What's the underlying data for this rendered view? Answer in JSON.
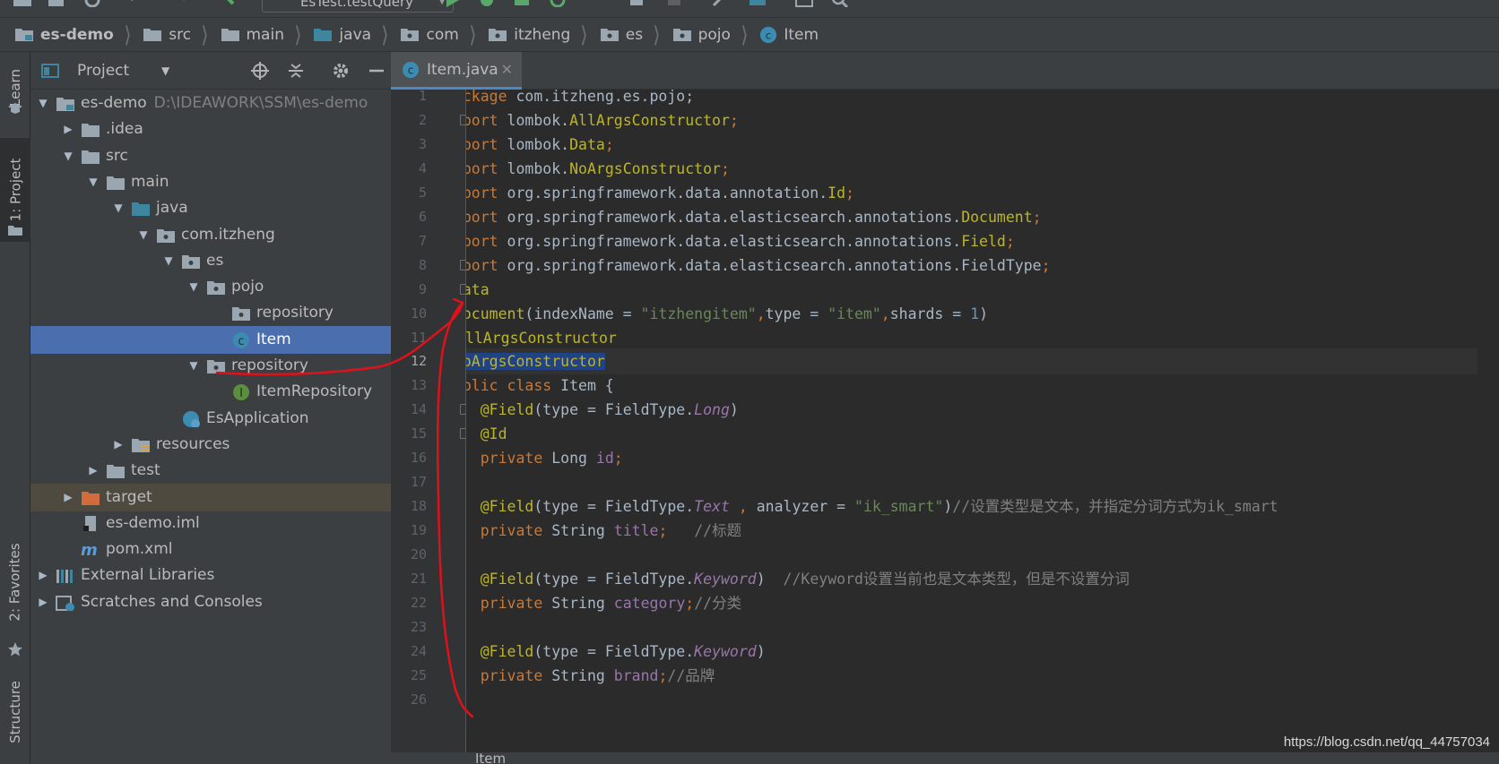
{
  "toolbar": {
    "run_config": "EsTest.testQuery"
  },
  "breadcrumb": [
    "es-demo",
    "src",
    "main",
    "java",
    "com",
    "itzheng",
    "es",
    "pojo",
    "Item"
  ],
  "left_strip": {
    "learn": "Learn",
    "project": "1: Project",
    "favorites": "2: Favorites",
    "structure": "Structure"
  },
  "project_panel": {
    "title": "Project",
    "tree": [
      {
        "label": "es-demo",
        "hint": "D:\\IDEAWORK\\SSM\\es-demo"
      },
      {
        "label": ".idea"
      },
      {
        "label": "src"
      },
      {
        "label": "main"
      },
      {
        "label": "java"
      },
      {
        "label": "com.itzheng"
      },
      {
        "label": "es"
      },
      {
        "label": "pojo"
      },
      {
        "label": "repository"
      },
      {
        "label": "Item"
      },
      {
        "label": "repository"
      },
      {
        "label": "ItemRepository"
      },
      {
        "label": "EsApplication"
      },
      {
        "label": "resources"
      },
      {
        "label": "test"
      },
      {
        "label": "target"
      },
      {
        "label": "es-demo.iml"
      },
      {
        "label": "pom.xml"
      },
      {
        "label": "External Libraries"
      },
      {
        "label": "Scratches and Consoles"
      }
    ]
  },
  "editor": {
    "tab": "Item.java",
    "line_numbers": [
      "1",
      "2",
      "3",
      "4",
      "5",
      "6",
      "7",
      "8",
      "9",
      "10",
      "11",
      "12",
      "13",
      "14",
      "15",
      "16",
      "17",
      "18",
      "19",
      "20",
      "21",
      "22",
      "23",
      "24",
      "25",
      "26"
    ],
    "lines": [
      [
        [
          "kw",
          "package "
        ],
        [
          "plain",
          "com.itzheng.es.pojo;"
        ]
      ],
      [
        [
          "kw",
          "import "
        ],
        [
          "plain",
          "lombok."
        ],
        [
          "ann",
          "AllArgsConstructor"
        ],
        [
          "kw",
          ";"
        ]
      ],
      [
        [
          "kw",
          "import "
        ],
        [
          "plain",
          "lombok."
        ],
        [
          "ann",
          "Data"
        ],
        [
          "kw",
          ";"
        ]
      ],
      [
        [
          "kw",
          "import "
        ],
        [
          "plain",
          "lombok."
        ],
        [
          "ann",
          "NoArgsConstructor"
        ],
        [
          "kw",
          ";"
        ]
      ],
      [
        [
          "kw",
          "import "
        ],
        [
          "plain",
          "org.springframework.data.annotation."
        ],
        [
          "ann",
          "Id"
        ],
        [
          "kw",
          ";"
        ]
      ],
      [
        [
          "kw",
          "import "
        ],
        [
          "plain",
          "org.springframework.data.elasticsearch.annotations."
        ],
        [
          "ann",
          "Document"
        ],
        [
          "kw",
          ";"
        ]
      ],
      [
        [
          "kw",
          "import "
        ],
        [
          "plain",
          "org.springframework.data.elasticsearch.annotations."
        ],
        [
          "ann",
          "Field"
        ],
        [
          "kw",
          ";"
        ]
      ],
      [
        [
          "kw",
          "import "
        ],
        [
          "plain",
          "org.springframework.data.elasticsearch.annotations.FieldType"
        ],
        [
          "kw",
          ";"
        ]
      ],
      [
        [
          "ann",
          "@Data"
        ]
      ],
      [
        [
          "ann",
          "@Document"
        ],
        [
          "plain",
          "(indexName = "
        ],
        [
          "str",
          "\"itzhengitem\""
        ],
        [
          "kw",
          ","
        ],
        [
          "plain",
          "type = "
        ],
        [
          "str",
          "\"item\""
        ],
        [
          "kw",
          ","
        ],
        [
          "plain",
          "shards = "
        ],
        [
          "num",
          "1"
        ],
        [
          "plain",
          ")"
        ]
      ],
      [
        [
          "ann",
          "@"
        ],
        [
          "bulb",
          ""
        ],
        [
          "ann",
          "llArgsConstructor"
        ]
      ],
      [
        [
          "sel",
          "@NoArgsConstructor"
        ]
      ],
      [
        [
          "kw",
          "public class "
        ],
        [
          "plain",
          "Item {"
        ]
      ],
      [
        [
          "plain",
          "    "
        ],
        [
          "ann",
          "@Field"
        ],
        [
          "plain",
          "(type = FieldType."
        ],
        [
          "ital",
          "Long"
        ],
        [
          "plain",
          ")"
        ]
      ],
      [
        [
          "plain",
          "    "
        ],
        [
          "ann",
          "@Id"
        ]
      ],
      [
        [
          "plain",
          "    "
        ],
        [
          "kw",
          "private "
        ],
        [
          "plain",
          "Long "
        ],
        [
          "fld",
          "id"
        ],
        [
          "kw",
          ";"
        ]
      ],
      [],
      [
        [
          "plain",
          "    "
        ],
        [
          "ann",
          "@Field"
        ],
        [
          "plain",
          "(type = FieldType."
        ],
        [
          "ital",
          "Text "
        ],
        [
          "kw",
          ", "
        ],
        [
          "plain",
          "analyzer = "
        ],
        [
          "str",
          "\"ik_smart\""
        ],
        [
          "plain",
          ")"
        ],
        [
          "cmt",
          "//设置类型是文本，并指定分词方式为ik_smart"
        ]
      ],
      [
        [
          "plain",
          "    "
        ],
        [
          "kw",
          "private "
        ],
        [
          "plain",
          "String "
        ],
        [
          "fld",
          "title"
        ],
        [
          "kw",
          ";   "
        ],
        [
          "cmt",
          "//标题"
        ]
      ],
      [],
      [
        [
          "plain",
          "    "
        ],
        [
          "ann",
          "@Field"
        ],
        [
          "plain",
          "(type = FieldType."
        ],
        [
          "ital",
          "Keyword"
        ],
        [
          "plain",
          ")  "
        ],
        [
          "cmt",
          "//Keyword设置当前也是文本类型，但是不设置分词"
        ]
      ],
      [
        [
          "plain",
          "    "
        ],
        [
          "kw",
          "private "
        ],
        [
          "plain",
          "String "
        ],
        [
          "fld",
          "category"
        ],
        [
          "kw",
          ";"
        ],
        [
          "cmt",
          "//分类"
        ]
      ],
      [],
      [
        [
          "plain",
          "    "
        ],
        [
          "ann",
          "@Field"
        ],
        [
          "plain",
          "(type = FieldType."
        ],
        [
          "ital",
          "Keyword"
        ],
        [
          "plain",
          ")"
        ]
      ],
      [
        [
          "plain",
          "    "
        ],
        [
          "kw",
          "private "
        ],
        [
          "plain",
          "String "
        ],
        [
          "fld",
          "brand"
        ],
        [
          "kw",
          ";"
        ],
        [
          "cmt",
          "//品牌"
        ]
      ],
      []
    ]
  },
  "bottom_strip": {
    "label": "Item"
  },
  "watermark": "https://blog.csdn.net/qq_44757034",
  "colors": {
    "selection": "#4b6eaf",
    "keyword": "#cc7832",
    "annotation": "#bbb529",
    "string": "#6a8759",
    "annotation_ink": "#e0111b"
  }
}
